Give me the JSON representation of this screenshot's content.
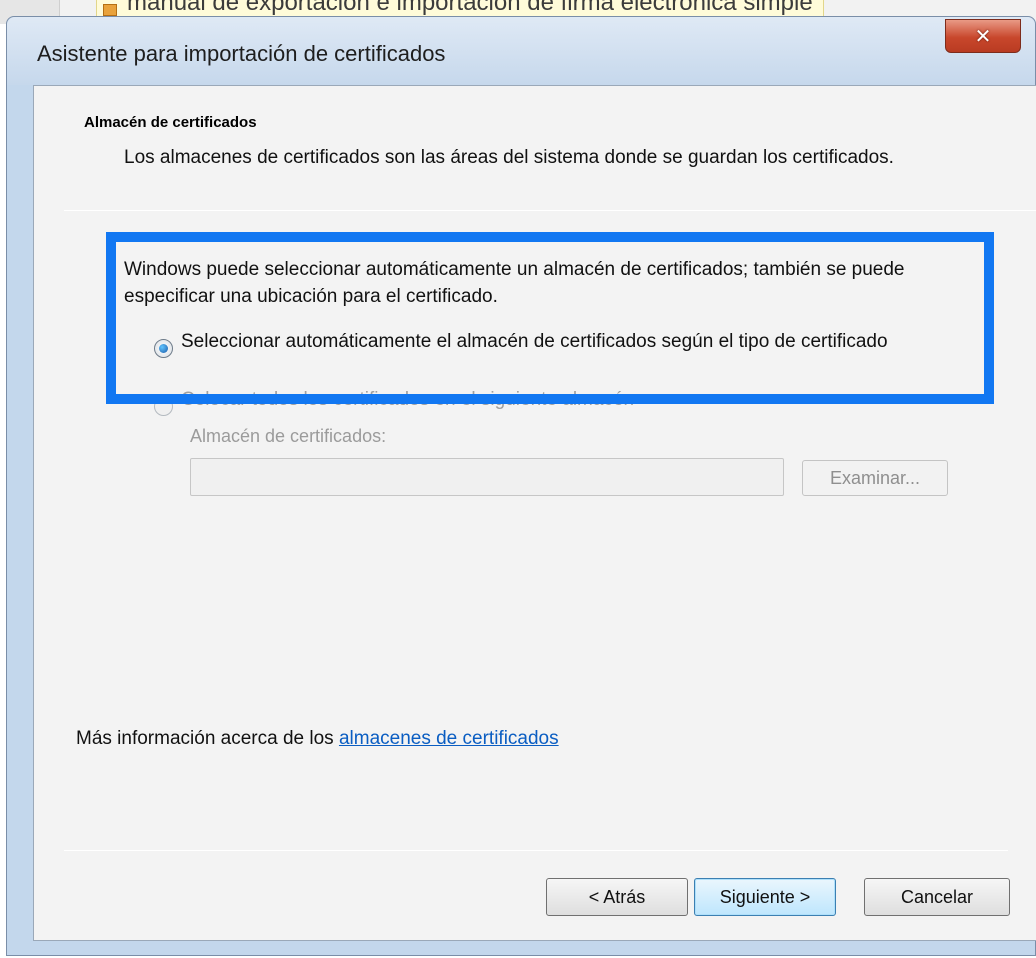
{
  "background": {
    "document_title": "manual de exportación e importación de firma electrónica simple"
  },
  "window": {
    "title": "Asistente para importación de certificados",
    "close_icon": "close-icon"
  },
  "page": {
    "section_title": "Almacén de certificados",
    "section_description": "Los almacenes de certificados son las áreas del sistema donde se guardan los certificados.",
    "intro": "Windows puede seleccionar automáticamente un almacén de certificados; también se puede especificar una ubicación para el certificado.",
    "options": [
      {
        "label": "Seleccionar automáticamente el almacén de certificados según el tipo de certificado",
        "selected": true,
        "enabled": true
      },
      {
        "label": "Colocar todos los certificados en el siguiente almacén",
        "selected": false,
        "enabled": false
      }
    ],
    "store_label": "Almacén de certificados:",
    "store_value": "",
    "browse_label": "Examinar...",
    "more_info_text": "Más información acerca de los ",
    "more_info_link": "almacenes de certificados"
  },
  "buttons": {
    "back": "< Atrás",
    "next": "Siguiente >",
    "cancel": "Cancelar"
  },
  "colors": {
    "highlight": "#1177f2",
    "link": "#0a5dc2",
    "close_button": "#c8472c"
  }
}
